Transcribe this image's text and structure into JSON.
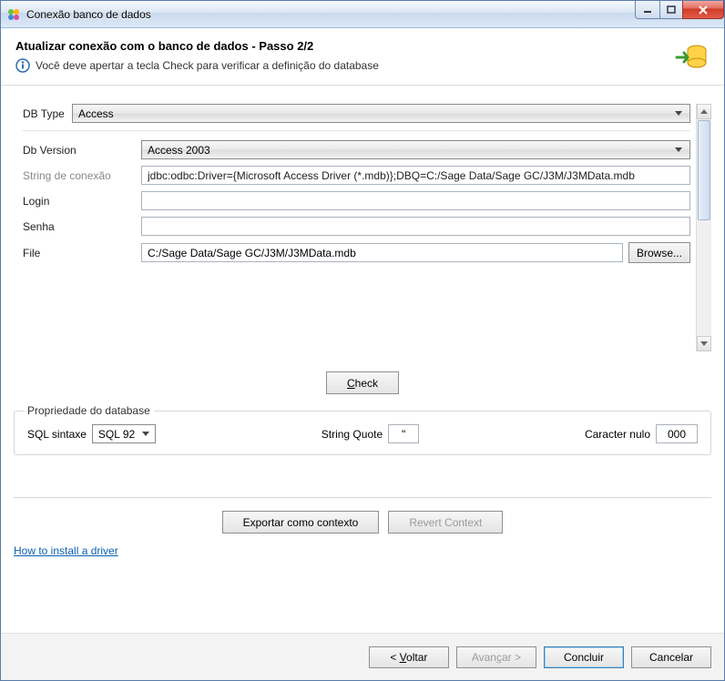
{
  "window": {
    "title": "Conexão banco de dados"
  },
  "header": {
    "title": "Atualizar conexão com o banco de dados - Passo 2/2",
    "message": "Você deve apertar a tecla Check para verificar a definição do database"
  },
  "form": {
    "dbTypeLabel": "DB Type",
    "dbTypeValue": "Access",
    "dbVersionLabel": "Db Version",
    "dbVersionValue": "Access 2003",
    "connStringLabel": "String de conexão",
    "connStringValue": "jdbc:odbc:Driver={Microsoft Access Driver (*.mdb)};DBQ=C:/Sage Data/Sage GC/J3M/J3MData.mdb",
    "loginLabel": "Login",
    "loginValue": "",
    "senhaLabel": "Senha",
    "senhaValue": "",
    "fileLabel": "File",
    "fileValue": "C:/Sage Data/Sage GC/J3M/J3MData.mdb",
    "browseLabel": "Browse..."
  },
  "checkButton": {
    "prefix": "C",
    "rest": "heck"
  },
  "properties": {
    "groupTitle": "Propriedade do database",
    "sqlSyntaxLabel": "SQL sintaxe",
    "sqlSyntaxValue": "SQL 92",
    "stringQuoteLabel": "String Quote",
    "stringQuoteValue": "\"",
    "nullCharLabel": "Caracter nulo",
    "nullCharValue": "000"
  },
  "contextButtons": {
    "export": "Exportar como contexto",
    "revert": "Revert Context"
  },
  "link": {
    "howto": "How to install a driver"
  },
  "footer": {
    "backPrefix": "< ",
    "backU": "V",
    "backRest": "oltar",
    "nextPrefix": "Avan",
    "nextU": "ç",
    "nextRest": "ar >",
    "finish": "Concluir",
    "cancel": "Cancelar"
  }
}
